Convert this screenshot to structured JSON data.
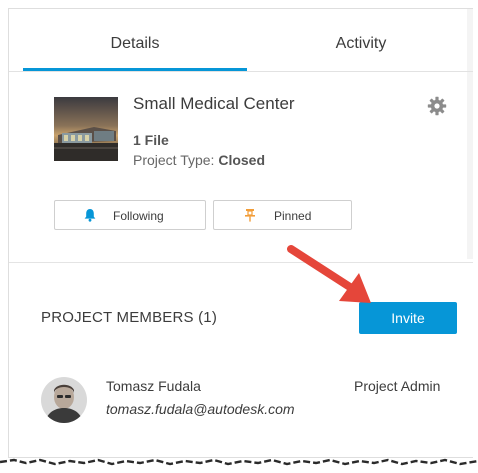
{
  "tabs": [
    {
      "label": "Details",
      "active": true
    },
    {
      "label": "Activity",
      "active": false
    }
  ],
  "project": {
    "name": "Small Medical Center",
    "file_count": "1 File",
    "type_label": "Project Type:",
    "type_value": "Closed",
    "thumbnail_icon": "building-photo"
  },
  "actions": {
    "following_label": "Following",
    "pinned_label": "Pinned"
  },
  "members": {
    "heading": "PROJECT MEMBERS (1)",
    "invite_label": "Invite",
    "list": [
      {
        "name": "Tomasz Fudala",
        "email": "tomasz.fudala@autodesk.com",
        "role": "Project Admin"
      }
    ]
  },
  "colors": {
    "accent": "#0696d7",
    "arrow": "#e5463a",
    "following_icon": "#0696d7",
    "pinned_icon": "#f29d38"
  }
}
